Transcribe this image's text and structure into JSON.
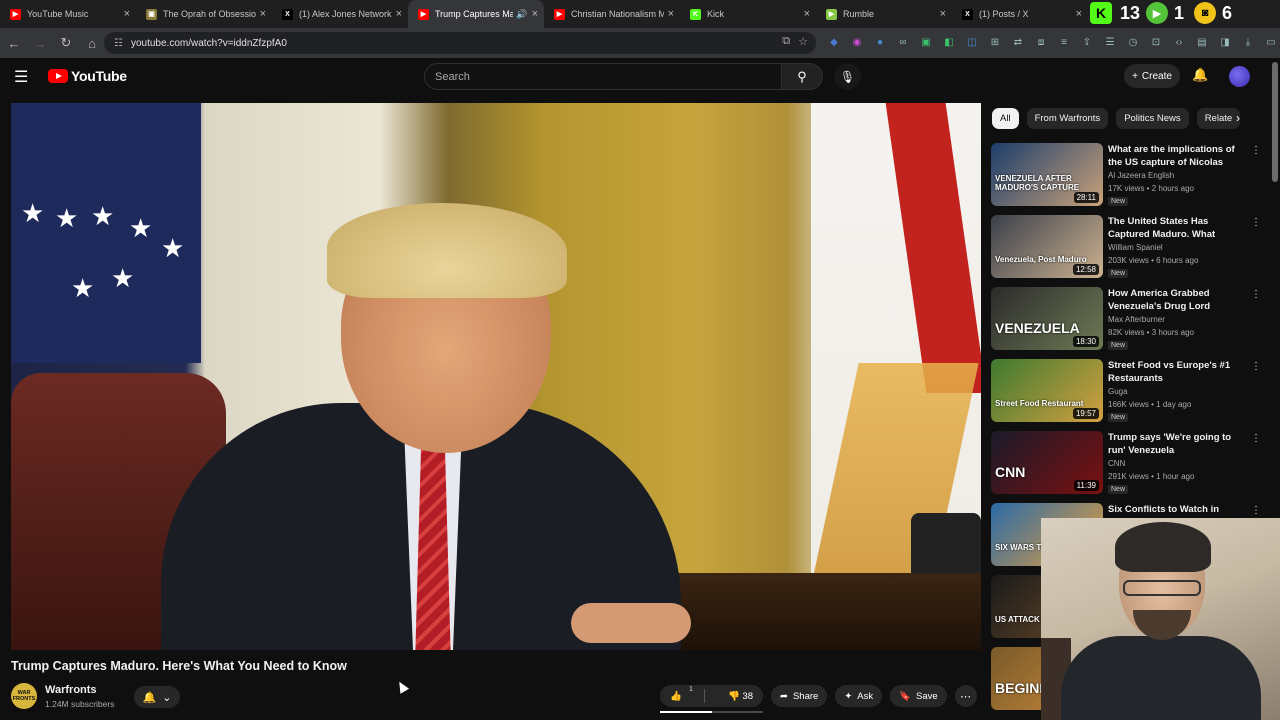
{
  "browser": {
    "tabs": [
      {
        "title": "YouTube Music",
        "fav_color": "#ff0000",
        "fav_glyph": "▶"
      },
      {
        "title": "The Oprah of Obsession",
        "fav_color": "#8a7a3a",
        "fav_glyph": "▣"
      },
      {
        "title": "(1) Alex Jones Network",
        "fav_color": "#000000",
        "fav_glyph": "X"
      },
      {
        "title": "Trump Captures Ma",
        "fav_color": "#ff0000",
        "fav_glyph": "▶",
        "active": true
      },
      {
        "title": "Christian Nationalism M",
        "fav_color": "#ff0000",
        "fav_glyph": "▶"
      },
      {
        "title": "Kick",
        "fav_color": "#53fc18",
        "fav_glyph": "K"
      },
      {
        "title": "Rumble",
        "fav_color": "#85c742",
        "fav_glyph": "▶"
      },
      {
        "title": "(1) Posts / X",
        "fav_color": "#000000",
        "fav_glyph": "X"
      }
    ],
    "ext_counts": [
      "13",
      "1",
      "6"
    ],
    "url": "youtube.com/watch?v=iddnZfzpfA0"
  },
  "masthead": {
    "logo_text": "YouTube",
    "search_placeholder": "Search",
    "create_label": "Create"
  },
  "video": {
    "title": "Trump Captures Maduro. Here's What You Need to Know",
    "channel": "Warfronts",
    "channel_avatar_text": "WAR FRONTS",
    "subscribers": "1.24M subscribers",
    "like_count": "1",
    "dislike_count": "38",
    "like_ratio": 0.5,
    "share_label": "Share",
    "ask_label": "Ask",
    "save_label": "Save"
  },
  "sidebar": {
    "chips": [
      "All",
      "From Warfronts",
      "Politics News",
      "Relate"
    ],
    "recs": [
      {
        "title": "What are the implications of the US capture of Nicolas Maduro...",
        "channel": "Al Jazeera English",
        "meta": "17K views • 2 hours ago",
        "badge": "New",
        "duration": "28:11",
        "thumb_text": "VENEZUELA AFTER MADURO'S CAPTURE",
        "c1": "#1b3d6b",
        "c2": "#c9a27a"
      },
      {
        "title": "The United States Has Captured Maduro. What Happens Next?",
        "channel": "William Spaniel",
        "meta": "203K views • 6 hours ago",
        "badge": "New",
        "duration": "12:58",
        "thumb_text": "Venezuela, Post Maduro",
        "c1": "#3a3f4a",
        "c2": "#cdb290"
      },
      {
        "title": "How America Grabbed Venezuela's Drug Lord Dictator",
        "channel": "Max Afterburner",
        "meta": "82K views • 3 hours ago",
        "badge": "New",
        "duration": "18:30",
        "thumb_text": "VENEZUELA",
        "c1": "#2b2b2b",
        "c2": "#6e7a55"
      },
      {
        "title": "Street Food vs Europe's #1 Restaurants",
        "channel": "Guga",
        "meta": "166K views • 1 day ago",
        "badge": "New",
        "duration": "19:57",
        "thumb_text": "Street Food   Restaurant",
        "c1": "#3d7a2f",
        "c2": "#d4a041"
      },
      {
        "title": "Trump says 'We're going to run' Venezuela",
        "channel": "CNN",
        "meta": "291K views • 1 hour ago",
        "badge": "New",
        "duration": "11:39",
        "thumb_text": "CNN",
        "c1": "#1a1a2a",
        "c2": "#7a1010"
      },
      {
        "title": "Six Conflicts to Watch in 2026",
        "channel": "",
        "meta": "",
        "badge": "",
        "duration": "",
        "thumb_text": "SIX WARS TO WATCH 2026",
        "c1": "#2a6aa8",
        "c2": "#e9a03a"
      },
      {
        "title": "",
        "channel": "",
        "meta": "",
        "badge": "",
        "duration": "",
        "thumb_text": "US ATTACK PLAN!",
        "c1": "#1a1a1a",
        "c2": "#6b4a2a"
      },
      {
        "title": "",
        "channel": "",
        "meta": "",
        "badge": "",
        "duration": "",
        "thumb_text": "BEGINNIN",
        "c1": "#7a5a2a",
        "c2": "#c98a3a"
      }
    ]
  }
}
